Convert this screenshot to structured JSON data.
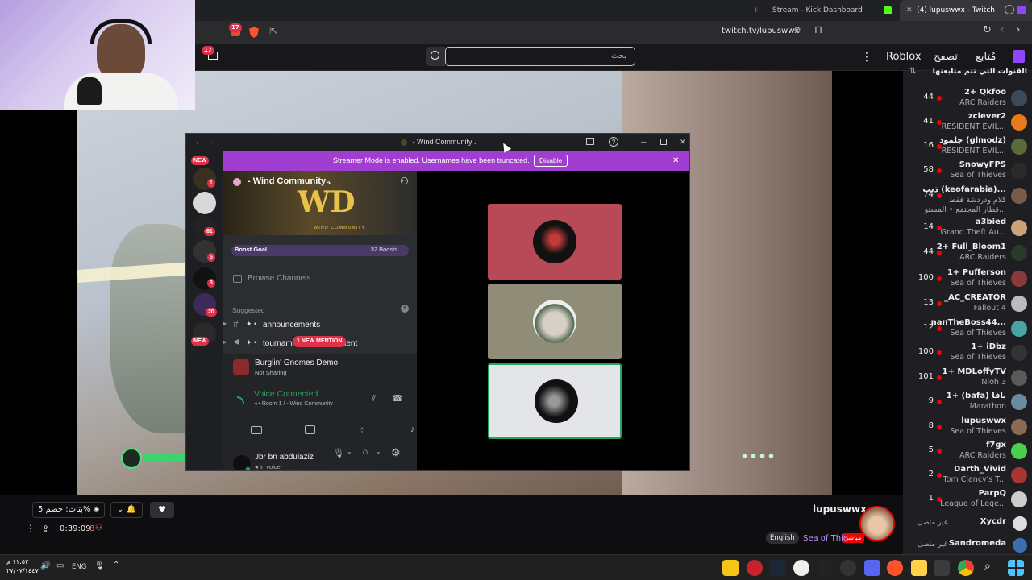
{
  "browser": {
    "tabs": [
      "Stream - Kick Dashboard",
      "(4) lupuswwx - Twitch"
    ],
    "url": "twitch.tv/lupuswwx",
    "notif_badge": "17"
  },
  "twitch_header": {
    "search_placeholder": "بحث",
    "nav": [
      "Roblox",
      "تصفح",
      "مُتابع"
    ],
    "followed_title": "القنوات التي تتم متابعتها"
  },
  "stream": {
    "streamer": "lupuswwx",
    "game": "Sea of Thie",
    "live_label": "مباشر",
    "language": "English",
    "uptime": "0:39:09",
    "viewers": "8",
    "drop_text": "بتات: خصم 5%"
  },
  "discord": {
    "window_title": "- Wind Community .",
    "banner_text": "Streamer Mode is enabled. Usernames have been truncated.",
    "banner_button": "Disable",
    "server_name": "- Wind Community .",
    "server_logo_text": "WD",
    "server_logo_sub": "WIND COMMUNITY",
    "boost_goal": "Boost Goal",
    "boosts": "32 Boosts",
    "browse_channels": "Browse Channels",
    "suggested": "Suggested",
    "channels": [
      "announcements",
      "tournam"
    ],
    "channel_tail": "ment",
    "mention_badge": "1 NEW MENTION",
    "new_label": "NEW",
    "rail_badges": [
      "1",
      "61",
      "5",
      "3",
      "20"
    ],
    "activity_title": "Burglin' Gnomes Demo",
    "activity_sub": "Not Sharing",
    "voice_status": "Voice Connected",
    "voice_room": "Room 1 / - Wind Community .",
    "user_name": "Jbr bn abdulaziz",
    "user_status": "In voice"
  },
  "followed_channels": [
    {
      "count": "44",
      "name": "2+ Qkfoo",
      "game": "ARC Raiders"
    },
    {
      "count": "41",
      "name": "zclever2",
      "game": "RESIDENT EVIL..."
    },
    {
      "count": "16",
      "name": "جلمود (glmodz)",
      "game": "RESIDENT EVIL..."
    },
    {
      "count": "58",
      "name": "SnowyFPS",
      "game": "Sea of Thieves"
    },
    {
      "count": "74",
      "name": "ذيب (keofarabia)...",
      "game": "كلام ودردشة فقط",
      "game2": "قطار المجتمع • المستو..."
    },
    {
      "count": "14",
      "name": "a3bied",
      "game": "Grand Theft Au..."
    },
    {
      "count": "44",
      "name": "2+ Full_Bloom1",
      "game": "ARC Raiders"
    },
    {
      "count": "100",
      "name": "1+ Pufferson",
      "game": "Sea of Thieves"
    },
    {
      "count": "13",
      "name": "_AC_CREATOR",
      "game": "Fallout 4"
    },
    {
      "count": "12",
      "name": "nanTheBoss44...",
      "game": "Sea of Thieves"
    },
    {
      "count": "100",
      "name": "1+ iDbz",
      "game": "Sea of Thieves"
    },
    {
      "count": "101",
      "name": "1+ MDLoffyTV",
      "game": "Nioh 3"
    },
    {
      "count": "9",
      "name": "1+ (bafa) بافا",
      "game": "Marathon"
    },
    {
      "count": "8",
      "name": "lupuswwx",
      "game": "Sea of Thieves"
    },
    {
      "count": "5",
      "name": "f7gx",
      "game": "ARC Raiders"
    },
    {
      "count": "2",
      "name": "Darth_Vivid",
      "game": "Tom Clancy's T..."
    },
    {
      "count": "1",
      "name": "ParpQ",
      "game": "League of Lege..."
    }
  ],
  "offline_channels": [
    {
      "name": "Xycdr",
      "status": "غير متصل"
    },
    {
      "name": "Sandromeda",
      "status": "غير متصل"
    }
  ],
  "taskbar": {
    "time": "١١:٥٣ م",
    "date": "٢٧/٠٧/١٤٤٧",
    "lang": "ENG"
  }
}
